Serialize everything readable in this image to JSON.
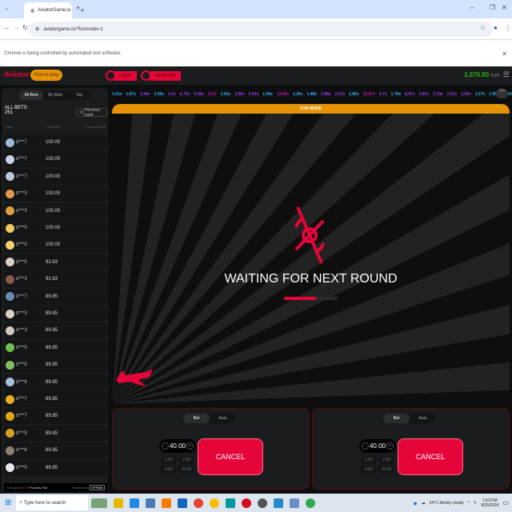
{
  "browser": {
    "tab_title": "AviatorGame.io",
    "url": "aviatorgame.io/?funmode=1",
    "info_bar": "Chrome is being controlled by automated test software."
  },
  "header": {
    "logo": "Aviator",
    "how_to_play": "How to play",
    "login": "LOGIN",
    "register": "REGISTER",
    "balance": "2,876.80",
    "currency": "EUR"
  },
  "bets": {
    "tabs": [
      "All Bets",
      "My Bets",
      "Top"
    ],
    "title": "ALL BETS",
    "count": "251",
    "previous_hand": "Previous hand",
    "col_user": "User",
    "col_bet": "Bet EUR",
    "col_cashout": "Cash out EUR",
    "rows": [
      [
        "d***7",
        "100.00"
      ],
      [
        "d***7",
        "100.00"
      ],
      [
        "d***7",
        "100.00"
      ],
      [
        "d***3",
        "100.00"
      ],
      [
        "d***3",
        "100.00"
      ],
      [
        "d***0",
        "100.00"
      ],
      [
        "d***0",
        "100.00"
      ],
      [
        "d***5",
        "92.63"
      ],
      [
        "d***3",
        "92.63"
      ],
      [
        "d***7",
        "89.85"
      ],
      [
        "d***3",
        "89.85"
      ],
      [
        "d***3",
        "89.85"
      ],
      [
        "d***5",
        "89.85"
      ],
      [
        "d***5",
        "89.85"
      ],
      [
        "d***6",
        "89.85"
      ],
      [
        "d***7",
        "89.85"
      ],
      [
        "d***7",
        "89.85"
      ],
      [
        "d***9",
        "89.85"
      ],
      [
        "d***6",
        "89.85"
      ],
      [
        "d***0",
        "89.85"
      ]
    ],
    "footer_left": "This game is",
    "provably_fair": "Provably Fair",
    "footer_right": "Powered by",
    "spribe": "SPRIBE"
  },
  "multipliers": [
    [
      "1.01x",
      "#34b4ff"
    ],
    [
      "1.07x",
      "#34b4ff"
    ],
    [
      "2.94x",
      "#913ef8"
    ],
    [
      "1.05x",
      "#34b4ff"
    ],
    [
      "2.2x",
      "#913ef8"
    ],
    [
      "6.73x",
      "#913ef8"
    ],
    [
      "5.69x",
      "#913ef8"
    ],
    [
      "117x",
      "#c017b4"
    ],
    [
      "1.52x",
      "#34b4ff"
    ],
    [
      "2.56x",
      "#913ef8"
    ],
    [
      "2.03x",
      "#913ef8"
    ],
    [
      "1.00x",
      "#34b4ff"
    ],
    [
      "13.36x",
      "#c017b4"
    ],
    [
      "1.25x",
      "#34b4ff"
    ],
    [
      "1.48x",
      "#34b4ff"
    ],
    [
      "2.89x",
      "#913ef8"
    ],
    [
      "2.23x",
      "#913ef8"
    ],
    [
      "1.85x",
      "#34b4ff"
    ],
    [
      "16.87x",
      "#c017b4"
    ],
    [
      "4.7x",
      "#913ef8"
    ],
    [
      "1.79x",
      "#34b4ff"
    ],
    [
      "8.97x",
      "#913ef8"
    ],
    [
      "3.87x",
      "#913ef8"
    ],
    [
      "2.19x",
      "#913ef8"
    ],
    [
      "2.22x",
      "#913ef8"
    ],
    [
      "2.02x",
      "#913ef8"
    ],
    [
      "1.27x",
      "#34b4ff"
    ],
    [
      "1.05x",
      "#34b4ff"
    ],
    [
      "1.03x",
      "#34b4ff"
    ]
  ],
  "game": {
    "fun_mode": "FUN MODE",
    "status": "WAITING FOR NEXT ROUND",
    "progress": 0.6
  },
  "panels": [
    {
      "tabs": [
        "Bet",
        "Auto"
      ],
      "amount": "40.00",
      "quick": [
        "1.00",
        "2.00",
        "5.00",
        "10.00"
      ],
      "action": "CANCEL"
    },
    {
      "tabs": [
        "Bet",
        "Auto"
      ],
      "amount": "40.00",
      "quick": [
        "1.00",
        "2.00",
        "5.00",
        "10.00"
      ],
      "action": "CANCEL"
    }
  ],
  "taskbar": {
    "search": "Type here to search",
    "weather": "24°C  Mostly cloudy",
    "time": "1:53 PM",
    "date": "9/25/2024"
  }
}
